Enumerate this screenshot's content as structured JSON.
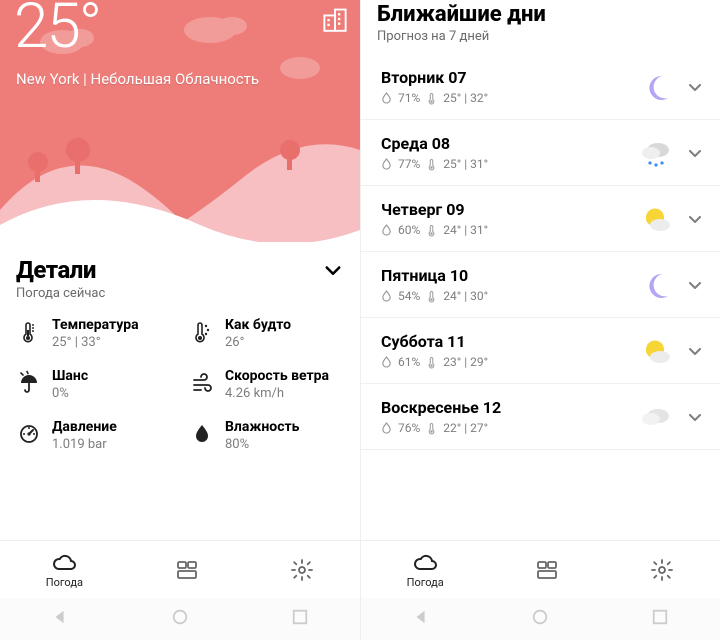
{
  "left": {
    "hero": {
      "temp": "25°",
      "location": "New York | Небольшая Облачность"
    },
    "details": {
      "title": "Детали",
      "subtitle": "Погода сейчас",
      "items": [
        {
          "label": "Температура",
          "value": "25° | 33°",
          "icon": "thermometer"
        },
        {
          "label": "Как будто",
          "value": "26°",
          "icon": "thermometer-dots"
        },
        {
          "label": "Шанс",
          "value": "0%",
          "icon": "umbrella"
        },
        {
          "label": "Скорость ветра",
          "value": "4.26 km/h",
          "icon": "wind"
        },
        {
          "label": "Давление",
          "value": "1.019 bar",
          "icon": "gauge"
        },
        {
          "label": "Влажность",
          "value": "80%",
          "icon": "droplet"
        }
      ]
    }
  },
  "right": {
    "title": "Ближайшие дни",
    "subtitle": "Прогноз на 7 дней",
    "days": [
      {
        "day": "Вторник 07",
        "humidity": "71%",
        "temps": "25° | 32°",
        "icon": "moon"
      },
      {
        "day": "Среда 08",
        "humidity": "77%",
        "temps": "25° | 31°",
        "icon": "rain"
      },
      {
        "day": "Четверг 09",
        "humidity": "60%",
        "temps": "24° | 31°",
        "icon": "sun"
      },
      {
        "day": "Пятница 10",
        "humidity": "54%",
        "temps": "24° | 30°",
        "icon": "moon"
      },
      {
        "day": "Суббота 11",
        "humidity": "61%",
        "temps": "23° | 29°",
        "icon": "sun"
      },
      {
        "day": "Воскресенье 12",
        "humidity": "76%",
        "temps": "22° | 27°",
        "icon": "cloud"
      }
    ]
  },
  "nav": {
    "weather": "Погода"
  }
}
